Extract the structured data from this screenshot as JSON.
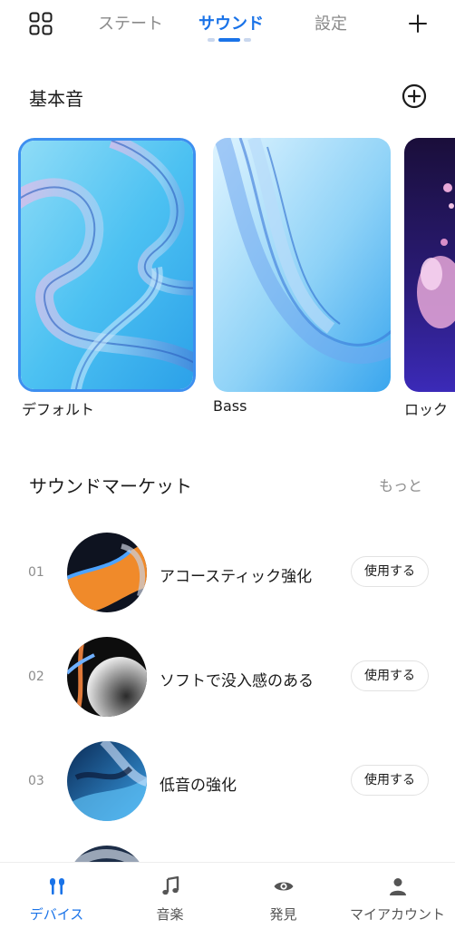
{
  "top_tabs": {
    "tab1": "ステート",
    "tab2": "サウンド",
    "tab3": "設定",
    "active": "サウンド"
  },
  "icons": {
    "menu": "grid-icon",
    "add": "plus-icon",
    "add_sound": "circle-plus-icon"
  },
  "basic_sounds": {
    "title": "基本音",
    "cards": [
      {
        "label": "デフォルト",
        "selected": true
      },
      {
        "label": "Bass",
        "selected": false
      },
      {
        "label": "ロック",
        "selected": false
      }
    ]
  },
  "market": {
    "title": "サウンドマーケット",
    "more": "もっと",
    "items": [
      {
        "num": "01",
        "title": "アコースティック強化",
        "button": "使用する"
      },
      {
        "num": "02",
        "title": "ソフトで没入感のある",
        "button": "使用する"
      },
      {
        "num": "03",
        "title": "低音の強化",
        "button": "使用する"
      }
    ]
  },
  "bottom_nav": {
    "items": [
      {
        "label": "デバイス",
        "icon": "earbuds-icon",
        "active": true
      },
      {
        "label": "音楽",
        "icon": "music-note-icon",
        "active": false
      },
      {
        "label": "発見",
        "icon": "eye-icon",
        "active": false
      },
      {
        "label": "マイアカウント",
        "icon": "person-icon",
        "active": false
      }
    ]
  },
  "colors": {
    "accent": "#1a73e8",
    "text": "#1b1b1b",
    "muted": "#8c8c8c"
  }
}
